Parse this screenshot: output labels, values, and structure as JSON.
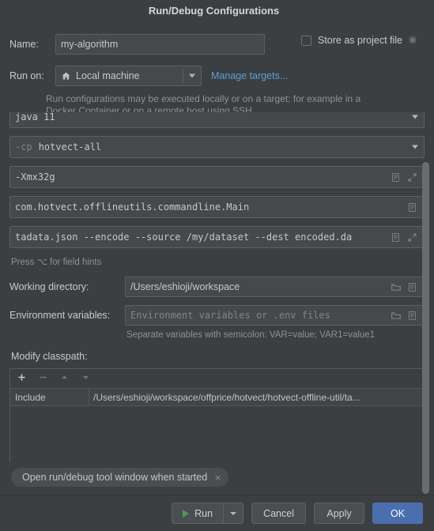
{
  "dialog": {
    "title": "Run/Debug Configurations"
  },
  "form": {
    "name_label": "Name:",
    "name_value": "my-algorithm",
    "store_as_project_file": "Store as project file",
    "gear_icon": "gear-icon",
    "run_on_label": "Run on:",
    "run_on_value": "Local machine",
    "run_on_icon": "home-icon",
    "manage_targets": "Manage targets...",
    "target_note": "Run configurations may be executed locally or on a target: for example in a Docker Container or on a remote host using SSH."
  },
  "fields": {
    "jre_value": "java 11",
    "cp_prefix": "-cp",
    "cp_value": "hotvect-all",
    "vm_options": "-Xmx32g",
    "main_class": "com.hotvect.offlineutils.commandline.Main",
    "program_args": "tadata.json --encode --source /my/dataset --dest encoded.da",
    "field_hint": "Press ⌥ for field hints",
    "expand_icon": "expand-icon",
    "macro_icon": "list-icon",
    "browse_icon": "folder-icon"
  },
  "paths": {
    "working_dir_label": "Working directory:",
    "working_dir_value": "/Users/eshioji/workspace",
    "env_label": "Environment variables:",
    "env_placeholder": "Environment variables or .env files",
    "env_note": "Separate variables with semicolon: VAR=value; VAR1=value1"
  },
  "classpath": {
    "label": "Modify classpath:",
    "toolbar": {
      "add": "add-icon",
      "remove": "remove-icon",
      "up": "move-up-icon",
      "down": "move-down-icon"
    },
    "columns": [
      "Include",
      ""
    ],
    "rows": [
      {
        "mode": "Include",
        "path": "/Users/eshioji/workspace/offprice/hotvect/hotvect-offline-util/ta..."
      }
    ]
  },
  "options": {
    "chip_label": "Open run/debug tool window when started",
    "chip_close_icon": "close-icon"
  },
  "buttons": {
    "run": "Run",
    "run_dropdown_icon": "chevron-down-icon",
    "cancel": "Cancel",
    "apply": "Apply",
    "ok": "OK"
  },
  "colors": {
    "dialog_bg": "#3C3F41",
    "field_bg": "#45494A",
    "link": "#5C9FD6",
    "primary_button": "#4B6EAF",
    "run_green": "#499C54"
  }
}
